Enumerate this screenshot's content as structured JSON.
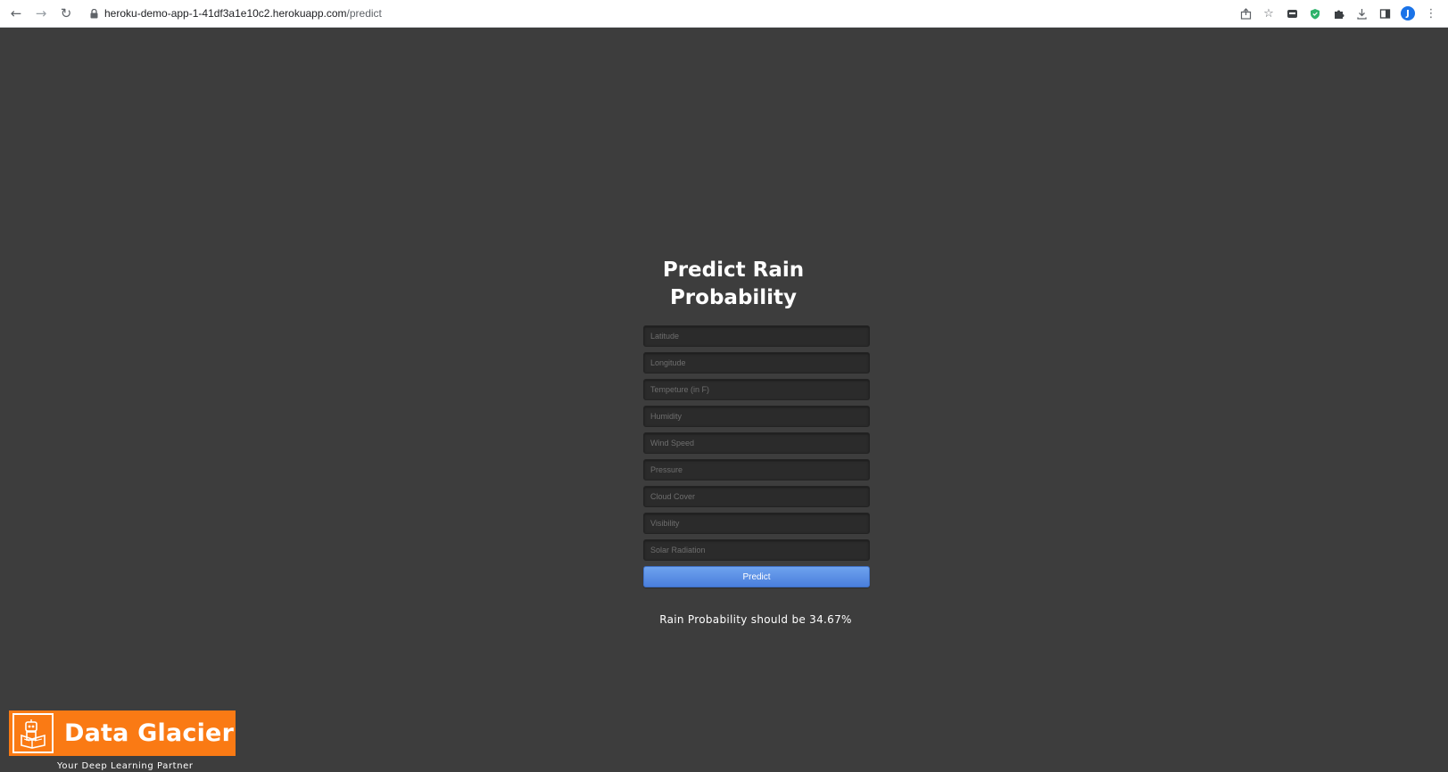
{
  "browser": {
    "back_icon": "back-arrow-icon",
    "forward_icon": "forward-arrow-icon",
    "reload_icon": "reload-icon",
    "lock_icon": "lock-icon",
    "url_host": "heroku-demo-app-1-41df3a1e10c2.herokuapp.com",
    "url_path": "/predict",
    "toolbar_icons": [
      "share-icon",
      "star-icon",
      "extension-icon",
      "shield-icon",
      "puzzle-icon",
      "download-icon",
      "sidepanel-icon"
    ],
    "profile_initial": "J",
    "menu_icon": "kebab-menu-icon"
  },
  "page": {
    "title_line1": "Predict Rain",
    "title_line2": "Probability",
    "fields": [
      {
        "placeholder": "Latitude",
        "value": ""
      },
      {
        "placeholder": "Longitude",
        "value": ""
      },
      {
        "placeholder": "Tempeture (in F)",
        "value": ""
      },
      {
        "placeholder": "Humidity",
        "value": ""
      },
      {
        "placeholder": "Wind Speed",
        "value": ""
      },
      {
        "placeholder": "Pressure",
        "value": ""
      },
      {
        "placeholder": "Cloud Cover",
        "value": ""
      },
      {
        "placeholder": "Visibility",
        "value": ""
      },
      {
        "placeholder": "Solar Radiation",
        "value": ""
      }
    ],
    "predict_label": "Predict",
    "result_text": "Rain Probability should be 34.67%"
  },
  "logo": {
    "name": "Data Glacier",
    "tagline": "Your Deep Learning Partner",
    "icon": "robot-reading-icon"
  },
  "colors": {
    "page_bg": "#3d3d3d",
    "logo_bg": "#fa7a14",
    "button_blue": "#4a7fdc"
  }
}
